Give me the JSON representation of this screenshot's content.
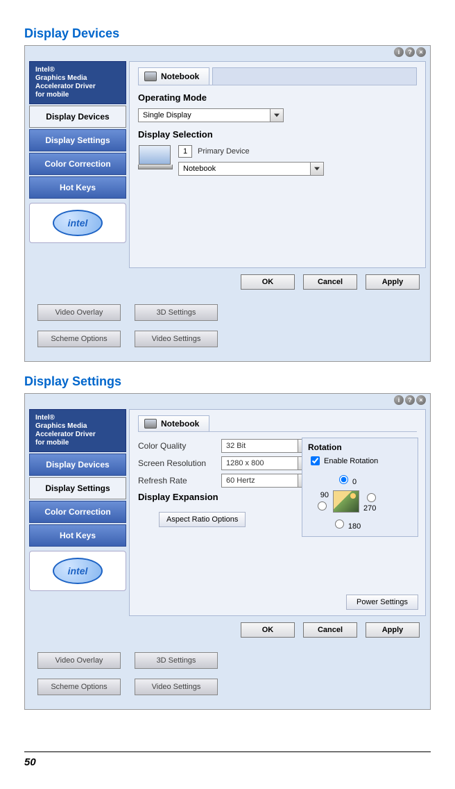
{
  "page_number": "50",
  "section1": {
    "title": "Display Devices",
    "brand": "Intel®\nGraphics Media\nAccelerator Driver\nfor mobile",
    "nav": [
      "Display Devices",
      "Display Settings",
      "Color Correction",
      "Hot Keys"
    ],
    "intel_text": "intel",
    "tab_label": "Notebook",
    "op_mode_label": "Operating Mode",
    "op_mode_value": "Single Display",
    "display_sel_label": "Display Selection",
    "primary_num": "1",
    "primary_label": "Primary Device",
    "primary_value": "Notebook",
    "ok": "OK",
    "cancel": "Cancel",
    "apply": "Apply",
    "bottom_buttons": [
      "Video Overlay",
      "3D Settings",
      "Scheme Options",
      "Video Settings"
    ]
  },
  "section2": {
    "title": "Display Settings",
    "brand": "Intel®\nGraphics Media\nAccelerator Driver\nfor mobile",
    "nav": [
      "Display Devices",
      "Display Settings",
      "Color Correction",
      "Hot Keys"
    ],
    "intel_text": "intel",
    "tab_label": "Notebook",
    "rows": [
      {
        "label": "Color Quality",
        "value": "32 Bit"
      },
      {
        "label": "Screen Resolution",
        "value": "1280 x 800"
      },
      {
        "label": "Refresh Rate",
        "value": "60 Hertz"
      }
    ],
    "display_exp_label": "Display Expansion",
    "aspect_btn": "Aspect Ratio Options",
    "rotation_label": "Rotation",
    "enable_rotation": "Enable Rotation",
    "angles": {
      "top": "0",
      "left": "90",
      "right": "270",
      "bottom": "180"
    },
    "power_btn": "Power Settings",
    "ok": "OK",
    "cancel": "Cancel",
    "apply": "Apply",
    "bottom_buttons": [
      "Video Overlay",
      "3D Settings",
      "Scheme Options",
      "Video Settings"
    ]
  }
}
